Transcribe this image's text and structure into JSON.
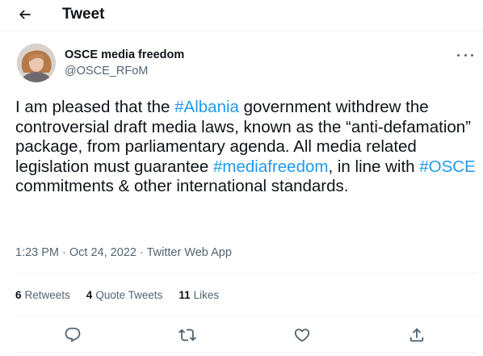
{
  "header": {
    "title": "Tweet",
    "back_icon": "arrow-left-icon"
  },
  "author": {
    "name": "OSCE media freedom",
    "handle": "@OSCE_RFoM",
    "avatar": "profile-photo"
  },
  "tweet": {
    "segments": [
      {
        "text": "I am pleased that the ",
        "hashtag": false
      },
      {
        "text": "#Albania",
        "hashtag": true
      },
      {
        "text": " government withdrew the controversial draft media laws, known as the “anti-defamation” package, from parliamentary agenda. All media related legislation must guarantee ",
        "hashtag": false
      },
      {
        "text": "#mediafreedom",
        "hashtag": true
      },
      {
        "text": ", in line with ",
        "hashtag": false
      },
      {
        "text": "#OSCE",
        "hashtag": true
      },
      {
        "text": " commitments & other international standards.",
        "hashtag": false
      }
    ],
    "time": "1:23 PM",
    "date": "Oct 24, 2022",
    "app": "Twitter Web App",
    "separator": "·"
  },
  "stats": {
    "retweets": {
      "count": "6",
      "label": "Retweets"
    },
    "quotes": {
      "count": "4",
      "label": "Quote Tweets"
    },
    "likes": {
      "count": "11",
      "label": "Likes"
    }
  },
  "actions": [
    "reply-icon",
    "retweet-icon",
    "like-icon",
    "share-icon"
  ],
  "colors": {
    "hashtag": "#1d9bf0",
    "text": "#0f1419",
    "secondary": "#536471",
    "divider": "#eff3f4"
  }
}
